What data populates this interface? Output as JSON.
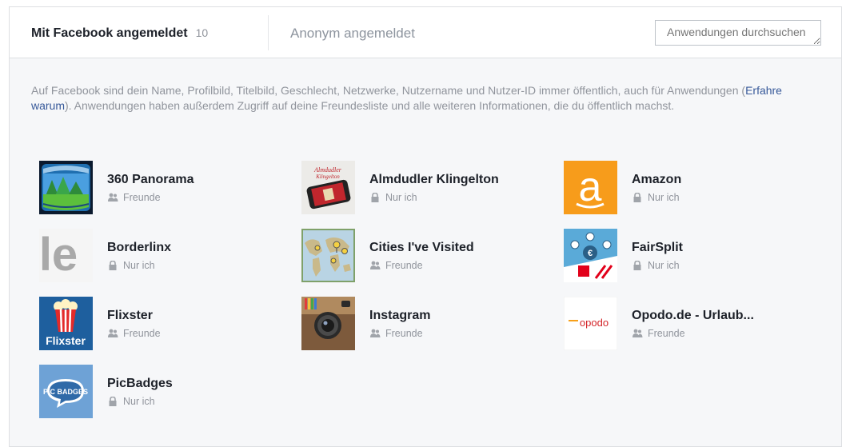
{
  "tabs": {
    "active_label": "Mit Facebook angemeldet",
    "active_count": "10",
    "inactive_label": "Anonym angemeldet"
  },
  "search": {
    "placeholder": "Anwendungen durchsuchen"
  },
  "info": {
    "text_before": "Auf Facebook sind dein Name, Profilbild, Titelbild, Geschlecht, Netzwerke, Nutzername und Nutzer-ID immer öffentlich, auch für Anwendungen (",
    "link": "Erfahre warum",
    "text_after": "). Anwendungen haben außerdem Zugriff auf deine Freundesliste und alle weiteren Informationen, die du öffentlich machst."
  },
  "apps": [
    {
      "name": "360 Panorama",
      "audience": "Freunde",
      "audience_icon": "friends-icon",
      "icon": "panorama-app-icon"
    },
    {
      "name": "Almdudler Klingelton",
      "audience": "Nur ich",
      "audience_icon": "lock-icon",
      "icon": "almdudler-app-icon",
      "icon_text": "Almdudler Klingelton"
    },
    {
      "name": "Amazon",
      "audience": "Nur ich",
      "audience_icon": "lock-icon",
      "icon": "amazon-app-icon",
      "icon_text": "a",
      "color": "#f79c1b"
    },
    {
      "name": "Borderlinx",
      "audience": "Nur ich",
      "audience_icon": "lock-icon",
      "icon": "borderlinx-app-icon",
      "icon_text": "le"
    },
    {
      "name": "Cities I've Visited",
      "audience": "Freunde",
      "audience_icon": "friends-icon",
      "icon": "cities-map-app-icon"
    },
    {
      "name": "FairSplit",
      "audience": "Nur ich",
      "audience_icon": "lock-icon",
      "icon": "fairsplit-app-icon",
      "icon_text": "€"
    },
    {
      "name": "Flixster",
      "audience": "Freunde",
      "audience_icon": "friends-icon",
      "icon": "flixster-app-icon",
      "icon_text": "Flixster"
    },
    {
      "name": "Instagram",
      "audience": "Freunde",
      "audience_icon": "friends-icon",
      "icon": "instagram-app-icon"
    },
    {
      "name": "Opodo.de - Urlaub...",
      "audience": "Freunde",
      "audience_icon": "friends-icon",
      "icon": "opodo-app-icon",
      "icon_text": "opodo"
    },
    {
      "name": "PicBadges",
      "audience": "Nur ich",
      "audience_icon": "lock-icon",
      "icon": "picbadges-app-icon",
      "icon_text": "PIC BADGES"
    }
  ]
}
